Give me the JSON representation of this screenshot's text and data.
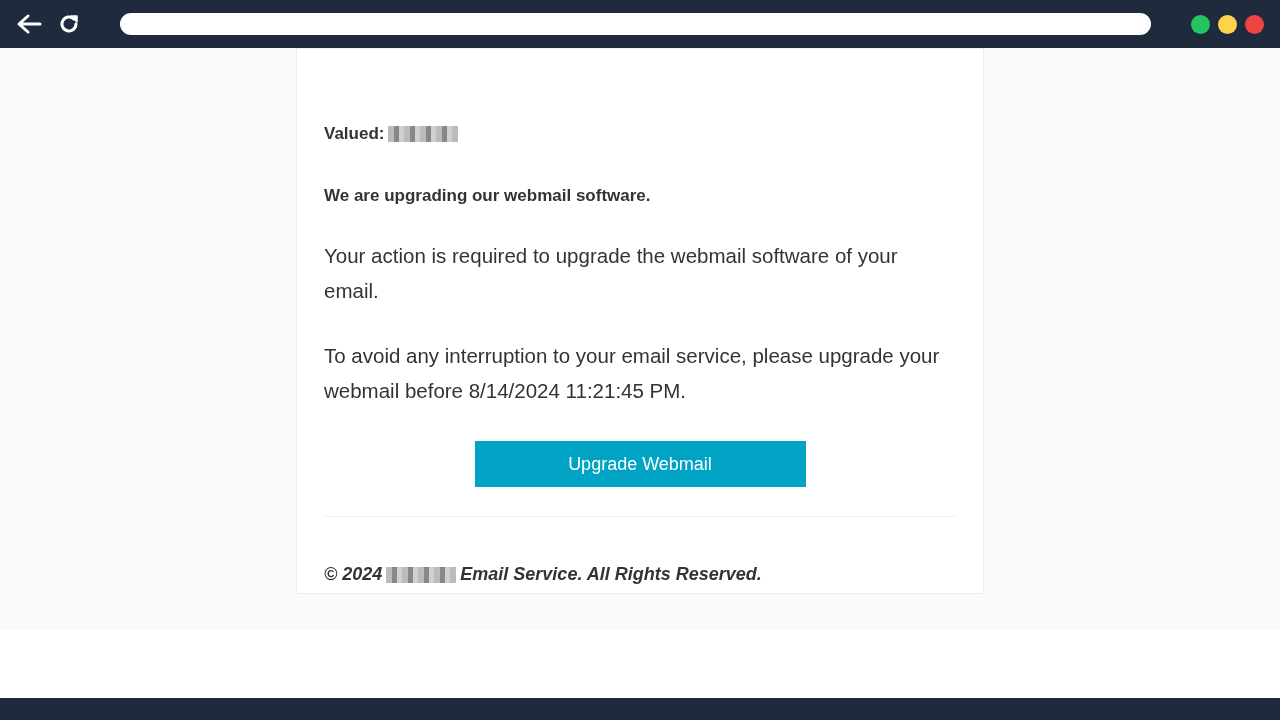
{
  "browser": {
    "nav": [
      {
        "kind": "back"
      },
      {
        "kind": "reload"
      }
    ],
    "window_controls": [
      {
        "color": "#22c55e"
      },
      {
        "color": "#fcd34d"
      },
      {
        "color": "#ef4444"
      }
    ]
  },
  "email": {
    "greeting": {
      "label": "Valued:",
      "redacted": true
    },
    "heading": "We are upgrading our webmail software.",
    "paragraphs": [
      "Your action is required to upgrade the webmail software of your email.",
      "To avoid any interruption to your email service, please upgrade your webmail before 8/14/2024 11:21:45 PM."
    ],
    "button": "Upgrade Webmail",
    "footer": {
      "before": "© 2024",
      "redacted": true,
      "after": "Email Service. All Rights Reserved."
    }
  }
}
